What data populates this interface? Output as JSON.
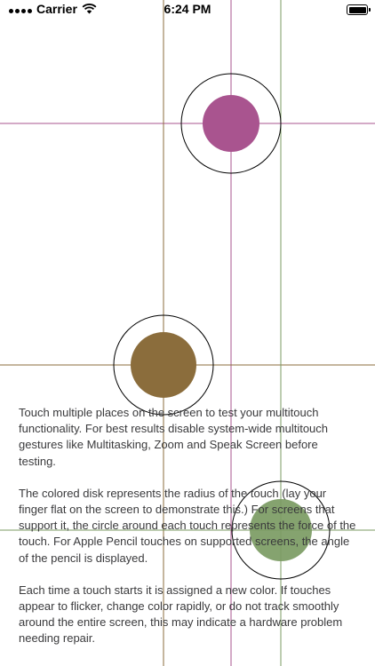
{
  "status_bar": {
    "carrier": "Carrier",
    "time": "6:24 PM",
    "wifi_icon": "wifi-icon",
    "signal_icon": "cellular-signal-icon",
    "battery_icon": "battery-full-icon"
  },
  "instructions": {
    "paragraph_1": "Touch multiple places on the screen to test your multitouch functionality. For best results disable system-wide multitouch gestures like Multitasking, Zoom and Speak Screen before testing.",
    "paragraph_2": "The colored disk represents the radius of the touch (lay your finger flat on the screen to demonstrate this.) For screens that support it, the circle around each touch represents the force of the touch. For Apple Pencil touches on supported screens, the angle of the pencil is displayed.",
    "paragraph_3": "Each time a touch starts it is assigned a new color. If touches appear to flicker, change color rapidly, or do not track smoothly around the entire screen, this may indicate a hardware problem needing repair."
  },
  "colors": {
    "touch_1": "#a9548f",
    "touch_2": "#8b6d3c",
    "touch_3": "#7b9b63",
    "extra_guide_line": "#8c8a5a",
    "force_circle_stroke": "#000000"
  }
}
